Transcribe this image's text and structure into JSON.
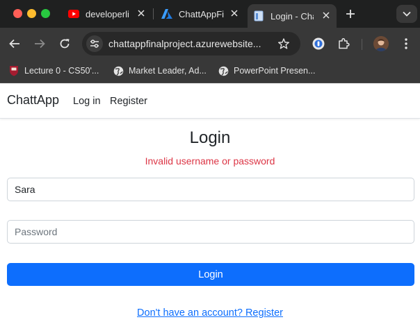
{
  "browser": {
    "tabs": [
      {
        "title": "developerli",
        "icon": "youtube-icon",
        "active": false
      },
      {
        "title": "ChattAppFi",
        "icon": "azure-icon",
        "active": false
      },
      {
        "title": "Login - Cha",
        "icon": "page-icon",
        "active": true
      }
    ],
    "address_url": "chattappfinalproject.azurewebsite...",
    "bookmarks": [
      {
        "label": "Lecture 0 - CS50'...",
        "icon": "harvard-shield-icon"
      },
      {
        "label": "Market Leader, Ad...",
        "icon": "globe-icon"
      },
      {
        "label": "PowerPoint Presen...",
        "icon": "globe-icon"
      }
    ]
  },
  "navbar": {
    "brand": "ChattApp",
    "links": [
      "Log in",
      "Register"
    ]
  },
  "login": {
    "heading": "Login",
    "error": "Invalid username or password",
    "username_value": "Sara",
    "password_placeholder": "Password",
    "submit_label": "Login",
    "register_link": "Don't have an account? Register"
  },
  "colors": {
    "primary": "#0d6efd",
    "error": "#dc3545",
    "chrome_dark": "#1f2020",
    "toolbar": "#383838"
  }
}
